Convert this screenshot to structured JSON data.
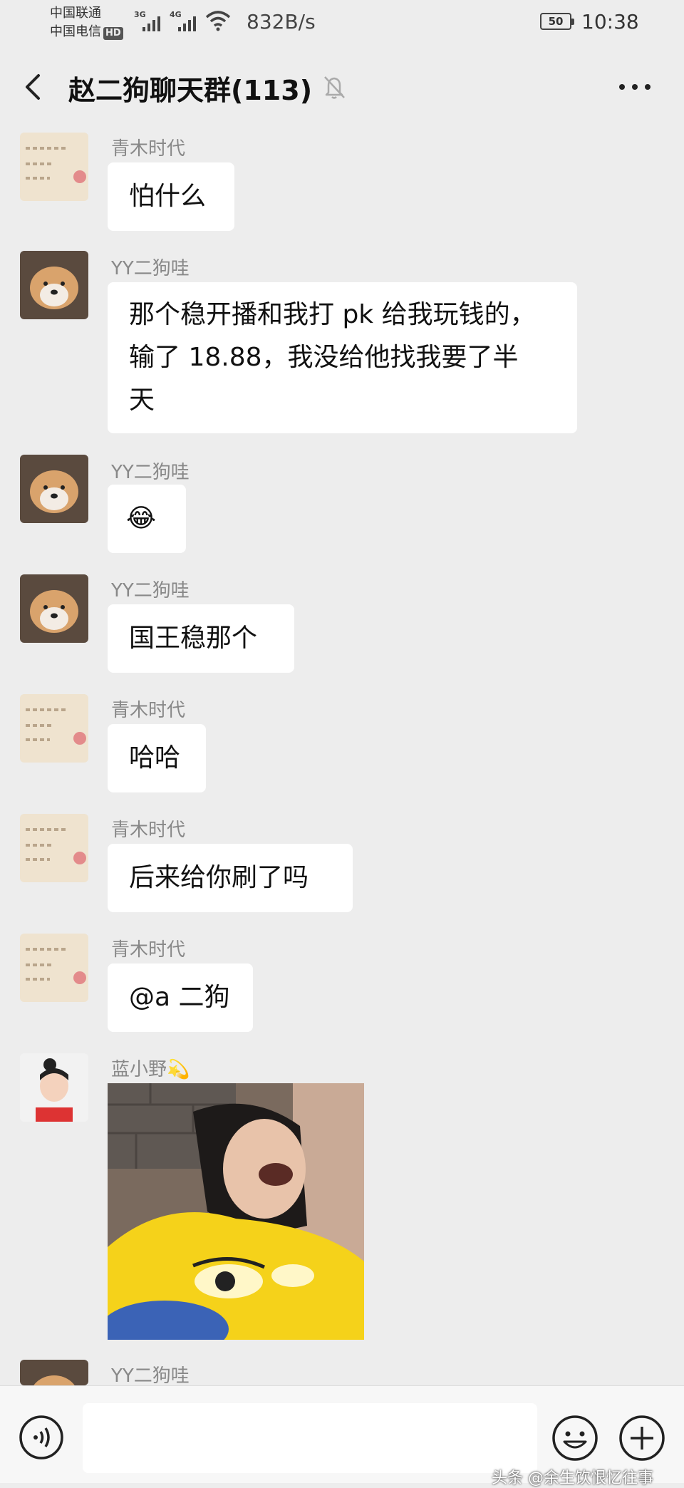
{
  "status_bar": {
    "carrier1": "中国联通",
    "carrier2": "中国电信",
    "carrier2_badge": "HD",
    "net1": "3G",
    "net2": "4G",
    "speed": "832B/s",
    "battery": "50",
    "time": "10:38"
  },
  "nav": {
    "title": "赵二狗聊天群(113)",
    "icons": [
      "back-icon",
      "mute-bell-icon",
      "more-icon"
    ]
  },
  "messages": [
    {
      "sender": "青木时代",
      "text": "怕什么",
      "avatar": "flower-text-avatar"
    },
    {
      "sender": "YY二狗哇",
      "lines": [
        "那个稳开播和我打 pk 给我玩钱的，",
        "输了 18.88，我没给他找我要了半",
        "天"
      ],
      "avatar": "shiba-dog-avatar"
    },
    {
      "sender": "YY二狗哇",
      "emoji": "😂",
      "avatar": "shiba-dog-avatar"
    },
    {
      "sender": "YY二狗哇",
      "text": "国王稳那个",
      "avatar": "shiba-dog-avatar"
    },
    {
      "sender": "青木时代",
      "text": "哈哈",
      "avatar": "flower-text-avatar"
    },
    {
      "sender": "青木时代",
      "text": "后来给你刷了吗",
      "avatar": "flower-text-avatar"
    },
    {
      "sender": "青木时代",
      "text": "@a 二狗",
      "avatar": "flower-text-avatar"
    },
    {
      "sender": "蓝小野",
      "sender_emoji": "💫",
      "image": "laughing-girl-photo",
      "avatar": "girl-avatar"
    },
    {
      "sender": "YY二狗哇",
      "avatar": "shiba-dog-avatar"
    }
  ],
  "bottom_bar": {
    "icons": [
      "voice-icon",
      "emoji-icon",
      "plus-icon"
    ],
    "input_value": ""
  },
  "watermark": "头条 @余生饮恨忆往事",
  "colors": {
    "background": "#ededed",
    "bubble": "#ffffff",
    "sender_text": "#888888"
  }
}
